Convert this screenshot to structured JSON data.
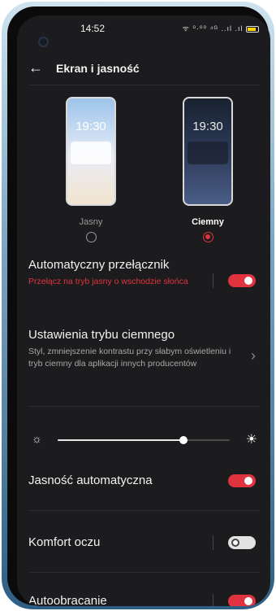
{
  "status": {
    "time": "14:52",
    "icons": "ᯤ ⁰·⁰⁰ ⁴ᴳ ..ıl .ıl"
  },
  "header": {
    "title": "Ekran i jasność"
  },
  "themes": {
    "light": {
      "clock": "19:30",
      "label": "Jasny",
      "selected": false
    },
    "dark": {
      "clock": "19:30",
      "label": "Ciemny",
      "selected": true
    }
  },
  "auto_switch": {
    "title": "Automatyczny przełącznik",
    "subtitle": "Przełącz na tryb jasny o wschodzie słońca",
    "enabled": true
  },
  "dark_settings": {
    "title": "Ustawienia trybu ciemnego",
    "subtitle": "Styl, zmniejszenie kontrastu przy słabym oświetleniu i tryb ciemny dla aplikacji innych producentów"
  },
  "brightness": {
    "level": 0.73
  },
  "auto_brightness": {
    "title": "Jasność automatyczna",
    "enabled": true
  },
  "eye_comfort": {
    "title": "Komfort oczu",
    "enabled": false
  },
  "auto_rotate": {
    "title": "Autoobracanie",
    "enabled": true
  },
  "colors": {
    "accent": "#e0333f",
    "background": "#1c1c1e"
  }
}
